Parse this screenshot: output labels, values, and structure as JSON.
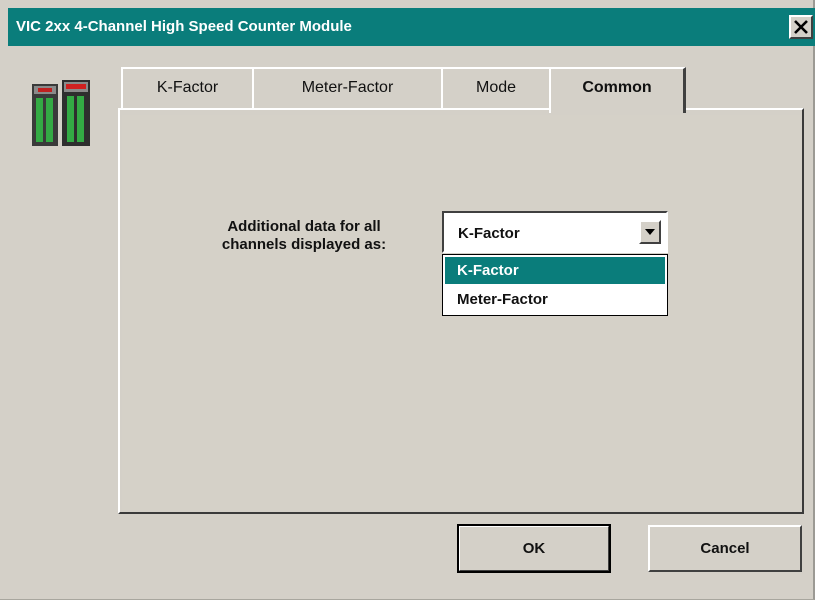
{
  "window": {
    "title": "VIC 2xx 4-Channel High Speed Counter Module"
  },
  "tabs": [
    {
      "label": "K-Factor",
      "active": false
    },
    {
      "label": "Meter-Factor",
      "active": false
    },
    {
      "label": "Mode",
      "active": false
    },
    {
      "label": "Common",
      "active": true
    }
  ],
  "common": {
    "label_line1": "Additional data for all",
    "label_line2": "channels displayed as:",
    "select": {
      "value": "K-Factor",
      "options": [
        "K-Factor",
        "Meter-Factor"
      ],
      "highlighted": "K-Factor"
    }
  },
  "buttons": {
    "ok": "OK",
    "cancel": "Cancel"
  },
  "colors": {
    "titlebar": "#0a7d7b",
    "face": "#d4d0c8",
    "highlight": "#0a7d7b"
  },
  "icons": {
    "close": "close-icon",
    "app": "io-module-icon",
    "dropdown": "chevron-down-icon"
  }
}
